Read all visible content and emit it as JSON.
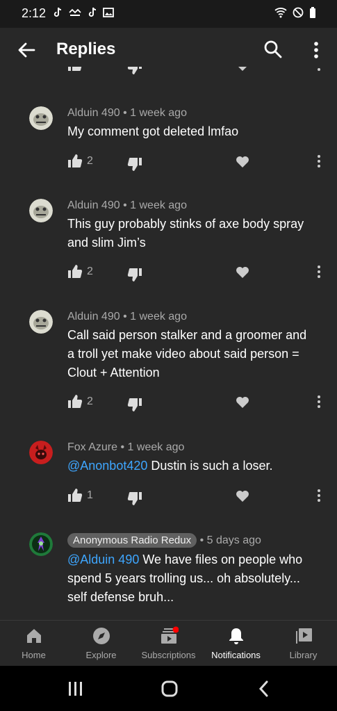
{
  "status_bar": {
    "time": "2:12"
  },
  "app_bar": {
    "title": "Replies"
  },
  "comments": [
    {
      "author": "Alduin 490",
      "age": "1 week ago",
      "text": "My comment got deleted lmfao",
      "likes": "2"
    },
    {
      "author": "Alduin 490",
      "age": "1 week ago",
      "text_lines": [
        "This guy probably stinks of axe body spray",
        "and slim Jim’s"
      ],
      "likes": "2"
    },
    {
      "author": "Alduin 490",
      "age": "1 week ago",
      "text_lines": [
        "Call said person stalker and a groomer and",
        "a troll yet make video about said person =",
        "Clout + Attention"
      ],
      "likes": "2"
    },
    {
      "author": "Fox Azure",
      "age": "1 week ago",
      "mention": "@Anonbot420",
      "text": "Dustin is such a loser.",
      "likes": "1"
    },
    {
      "author": "Anonymous Radio Redux",
      "age": "5 days ago",
      "mention": "@Alduin 490",
      "text_lines": [
        "We have files on people who",
        "spend 5 years trolling us... oh absolutely...",
        "self defense bruh..."
      ]
    }
  ],
  "separator": "•",
  "bottom_nav": {
    "items": [
      {
        "label": "Home",
        "icon": "home-icon"
      },
      {
        "label": "Explore",
        "icon": "compass-icon"
      },
      {
        "label": "Subscriptions",
        "icon": "subscriptions-icon"
      },
      {
        "label": "Notifications",
        "icon": "bell-icon"
      },
      {
        "label": "Library",
        "icon": "library-icon"
      }
    ],
    "active": "Notifications"
  },
  "colors": {
    "background": "#282828",
    "mention": "#3ea6ff",
    "notification_dot": "#ff0000"
  }
}
